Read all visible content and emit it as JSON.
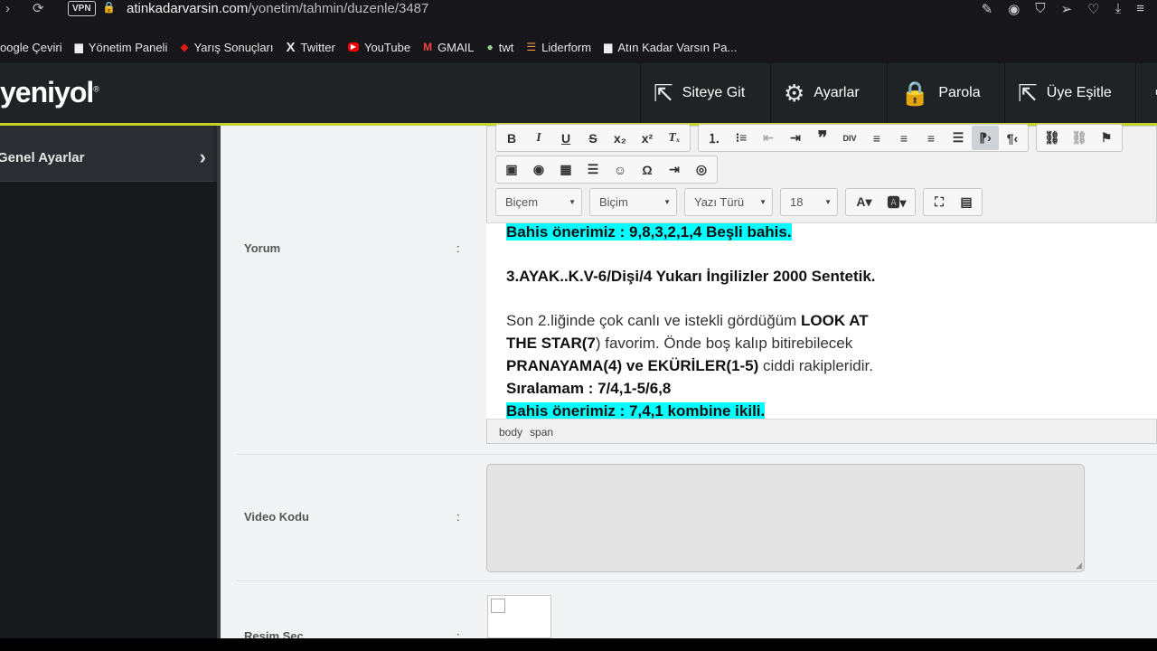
{
  "browser": {
    "back_icon": "chevron-right",
    "reload_icon": "reload",
    "vpn": "VPN",
    "url_domain": "atinkadarvarsin.com",
    "url_path": "/yonetim/tahmin/duzenle/3487"
  },
  "bookmarks": [
    {
      "label": "oogle Çeviri",
      "icon": "translate-icon"
    },
    {
      "label": "Yönetim Paneli",
      "icon": "page-icon"
    },
    {
      "label": "Yarış Sonuçları",
      "icon": "horse-icon"
    },
    {
      "label": "Twitter",
      "icon": "x-icon"
    },
    {
      "label": "YouTube",
      "icon": "youtube-icon"
    },
    {
      "label": "GMAIL",
      "icon": "gmail-icon"
    },
    {
      "label": "twt",
      "icon": "globe-icon"
    },
    {
      "label": "Liderform",
      "icon": "bars-icon"
    },
    {
      "label": "Atın Kadar Varsın Pa...",
      "icon": "page-icon"
    }
  ],
  "header": {
    "logo": "yeniyol",
    "logo_mark": "®",
    "menu": [
      {
        "label": "Siteye Git",
        "icon": "external-link-icon"
      },
      {
        "label": "Ayarlar",
        "icon": "gear-icon"
      },
      {
        "label": "Parola",
        "icon": "lock-icon"
      },
      {
        "label": "Üye Eşitle",
        "icon": "external-link-icon"
      }
    ]
  },
  "sidebar": {
    "items": [
      {
        "label": "Genel Ayarlar"
      }
    ]
  },
  "form": {
    "colon": ":",
    "yorum_label": "Yorum",
    "video_label": "Video Kodu",
    "resim_label": "Resim Seç"
  },
  "editor": {
    "combos": [
      "Biçem",
      "Biçim",
      "Yazı Türü",
      "18"
    ],
    "path": [
      "body",
      "span"
    ],
    "lines": {
      "l1": "Bahis önerimiz : 9,8,3,2,1,4 Beşli bahis.",
      "l2": "3.AYAK..K.V-6/Dişi/4 Yukarı İngilizler 2000 Sentetik.",
      "l3a": "Son 2.liğinde çok canlı ve istekli gördüğüm ",
      "l3b": "LOOK AT",
      "l4a": "THE STAR(7",
      "l4b": ") favorim. Önde boş kalıp bitirebilecek",
      "l5a": "PRANAYAMA(4)",
      "l5b": " ve ",
      "l5c": "EKÜRİLER(1-5)",
      "l5d": " ciddi rakipleridir.",
      "l6": "Sıralamam : 7/4,1-5/6,8",
      "l7": "Bahis önerimiz : 7,4,1 kombine ikili."
    }
  }
}
